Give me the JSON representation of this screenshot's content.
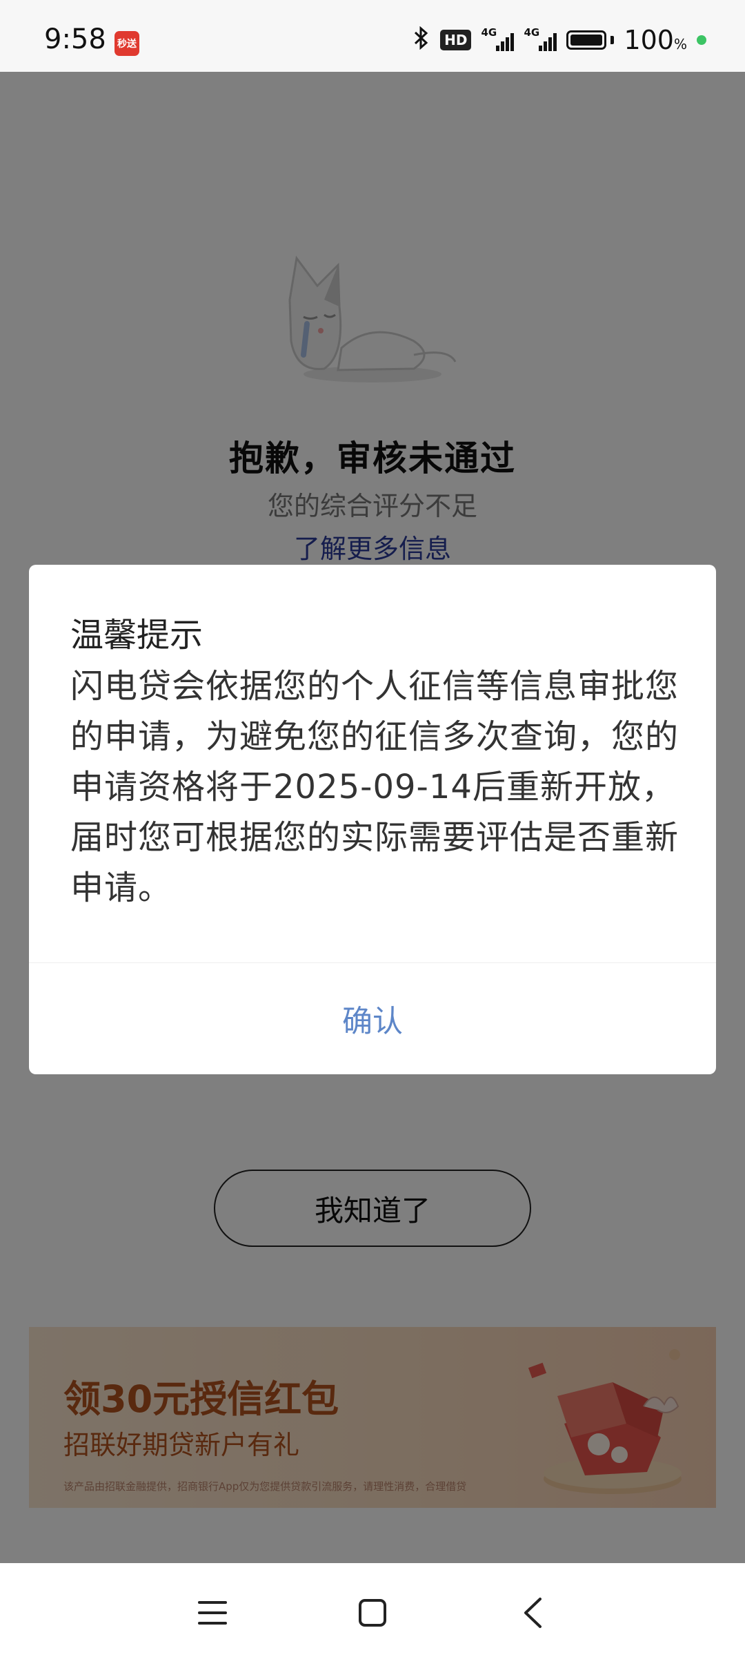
{
  "status_bar": {
    "time": "9:58",
    "app_badge": "秒送",
    "hd_label": "HD",
    "network_1": "4G",
    "network_2": "4G",
    "battery_percent": "100",
    "battery_unit": "%"
  },
  "result": {
    "title": "抱歉，审核未通过",
    "subtitle": "您的综合评分不足",
    "link": "了解更多信息"
  },
  "dialog": {
    "title": "温馨提示",
    "body": "闪电贷会依据您的个人征信等信息审批您的申请，为避免您的征信多次查询，您的申请资格将于2025-09-14后重新开放，届时您可根据您的实际需要评估是否重新申请。",
    "confirm_label": "确认"
  },
  "acknowledge_button": "我知道了",
  "promo": {
    "title": "领30元授信红包",
    "subtitle": "招联好期贷新户有礼",
    "disclaimer": "该产品由招联金融提供，招商银行App仅为您提供贷款引流服务，请理性消费，合理借贷"
  },
  "colors": {
    "overlay": "#808080",
    "link": "#2a3a9a",
    "confirm": "#5d86c8",
    "promo_text": "#b2531e"
  }
}
